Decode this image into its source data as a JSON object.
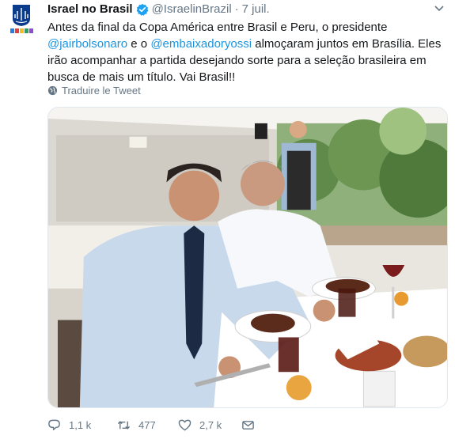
{
  "account": {
    "name": "Israel no Brasil",
    "handle": "@IsraelinBrazil",
    "separator": "·",
    "date": "7 juil.",
    "verified": true,
    "avatar_icon": "israel-embassy-emblem"
  },
  "tweet": {
    "part1": "Antes da final da Copa América entre Brasil e Peru, o presidente ",
    "mention1": "@jairbolsonaro",
    "part2": " e o ",
    "mention2": "@embaixadoryossi",
    "part3": " almoçaram juntos em Brasília. Eles irão acompanhar a partida desejando sorte para a seleção brasileira em busca de mais um título. Vai Brasil!!"
  },
  "translate": {
    "label": "Traduire le Tweet",
    "icon": "globe-icon"
  },
  "media": {
    "description_icon": "photo-lunch-table"
  },
  "actions": {
    "reply_count": "1,1 k",
    "retweet_count": "477",
    "like_count": "2,7 k",
    "mail_icon": "envelope-icon"
  },
  "colors": {
    "link": "#1b95e0",
    "verified": "#1da1f2",
    "muted": "#657786"
  }
}
